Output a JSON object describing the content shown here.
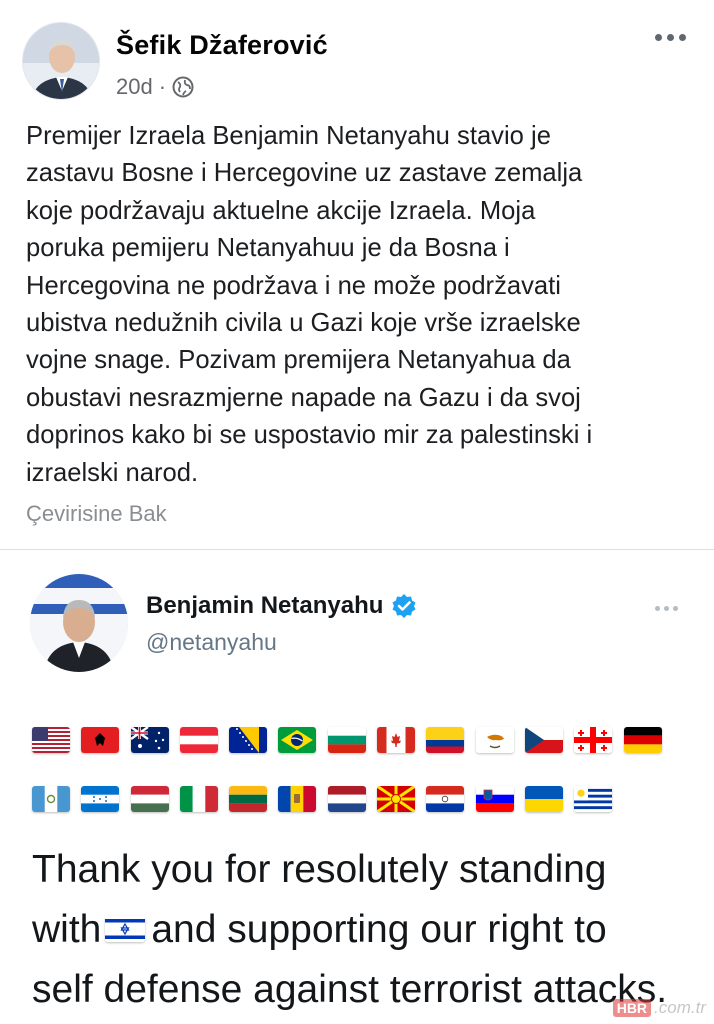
{
  "post": {
    "author": "Šefik Džaferović",
    "time": "20d",
    "separator": "·",
    "privacy_icon": "globe-icon",
    "body": "Premijer Izraela Benjamin Netanyahu stavio je\nzastavu Bosne i Hercegovine uz zastave zemalja\nkoje podržavaju aktuelne akcije Izraela. Moja\nporuka pemijeru Netanyahuu je da Bosna i\nHercegovina ne podržava i ne može podržavati\nubistva nedužnih civila u Gazi koje vrše izraelske\nvojne snage. Pozivam premijera Netanyahua da\nobustavi nesrazmjerne napade na Gazu i da svoj\ndoprinos kako bi se uspostavio mir za palestinski i\nizraelski narod.",
    "translate_link": "Çevirisine Bak",
    "more_icon": "ellipsis-icon"
  },
  "tweet": {
    "name": "Benjamin Netanyahu",
    "handle": "@netanyahu",
    "verified_icon": "verified-badge-icon",
    "flags_row1": [
      "united-states",
      "albania",
      "australia",
      "austria",
      "bosnia-and-herzegovina",
      "brazil",
      "bulgaria",
      "canada",
      "colombia",
      "cyprus",
      "czechia",
      "georgia",
      "germany"
    ],
    "flags_row2": [
      "guatemala",
      "honduras",
      "hungary",
      "italy",
      "lithuania",
      "moldova",
      "netherlands",
      "north-macedonia",
      "paraguay",
      "slovenia",
      "ukraine",
      "uruguay"
    ],
    "text_line1": "Thank you for resolutely standing",
    "text_with": "with",
    "text_line2_rest": "and supporting our right to",
    "text_line3": "self defense against terrorist attacks.",
    "inline_flag": "israel"
  },
  "watermark": {
    "badge": "HBR",
    "domain": ".com.tr"
  },
  "colors": {
    "facebook_text": "#1c1e21",
    "facebook_meta": "#65676b",
    "twitter_handle": "#657786",
    "verified_blue": "#1da1f2"
  }
}
